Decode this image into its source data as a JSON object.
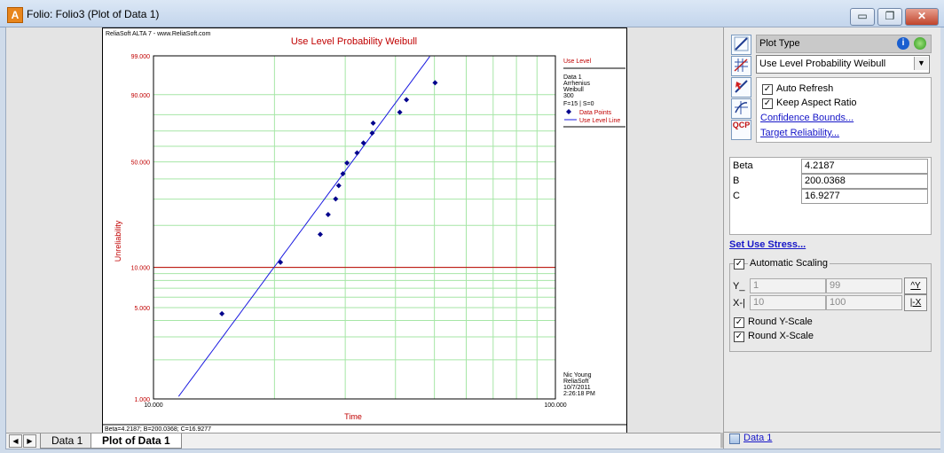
{
  "window": {
    "title": "Folio: Folio3 (Plot of Data 1)",
    "app_icon": "A",
    "minimize_glyph": "▭",
    "restore_glyph": "❐",
    "close_glyph": "✕"
  },
  "plot": {
    "header": "ReliaSoft ALTA 7 - www.ReliaSoft.com",
    "title": "Use Level Probability Weibull",
    "ylabel": "Unreliability",
    "xlabel": "Time",
    "footer": "Beta=4.2187; B=200.0368; C=16.9277",
    "legend": {
      "heading": "Use Level",
      "lines": [
        "Data 1",
        "Arrhenius",
        "Weibull",
        "300",
        "F=15 | S=0"
      ],
      "points_label": "Data Points",
      "line_label": "Use Level Line"
    },
    "signature": [
      "Nic Young",
      "ReliaSoft",
      "10/7/2011",
      "2:26:18 PM"
    ]
  },
  "chart_data": {
    "type": "scatter",
    "title": "Use Level Probability Weibull",
    "xlabel": "Time",
    "ylabel": "Unreliability",
    "xscale": "log",
    "yscale": "weibull",
    "xlim": [
      10000,
      100000
    ],
    "ylim": [
      1,
      99
    ],
    "x_ticks": [
      "10.000",
      "100.000"
    ],
    "y_ticks": [
      "1.000",
      "5.000",
      "10.000",
      "50.000",
      "90.000",
      "99.000"
    ],
    "x_tick_values": [
      10000,
      100000
    ],
    "y_tick_values": [
      1,
      5,
      10,
      50,
      90,
      99
    ],
    "x_grid": [
      10000,
      20000,
      30000,
      40000,
      50000,
      60000,
      70000,
      80000,
      90000,
      100000
    ],
    "y_grid": [
      1,
      2,
      3,
      4,
      5,
      6,
      7,
      8,
      9,
      10,
      20,
      30,
      40,
      50,
      60,
      70,
      80,
      90,
      99
    ],
    "highlight_y": 10,
    "series": [
      {
        "name": "Data Points",
        "points": [
          [
            14800,
            4.5
          ],
          [
            20700,
            10.9
          ],
          [
            26000,
            17.3
          ],
          [
            27200,
            23.7
          ],
          [
            28400,
            30.1
          ],
          [
            28900,
            36.5
          ],
          [
            29600,
            42.9
          ],
          [
            30300,
            49.3
          ],
          [
            32100,
            55.7
          ],
          [
            33300,
            62.2
          ],
          [
            35000,
            68.6
          ],
          [
            35200,
            75.0
          ],
          [
            41000,
            81.4
          ],
          [
            42600,
            87.8
          ],
          [
            50200,
            94.2
          ]
        ]
      },
      {
        "name": "Use Level Line",
        "line": {
          "beta": 4.2187,
          "eta": 34000
        }
      }
    ],
    "colors": {
      "grid": "#a6e6a6",
      "points": "#00008c",
      "line": "#1a1ae0",
      "highlight": "#c00000",
      "ticks": "#c00000"
    }
  },
  "tabs": {
    "first_glyph": "◀",
    "next_glyph": "▶",
    "items": [
      "Data 1",
      "Plot of Data 1"
    ]
  },
  "panel": {
    "tool_icons": [
      "plot-line-icon",
      "plot-grid-icon",
      "reliability-pointer-icon",
      "grid-chart-icon",
      "qcp-icon"
    ],
    "qcp_label": "QCP",
    "plot_type_label": "Plot Type",
    "plot_type_value": "Use Level Probability Weibull",
    "info_glyph": "i",
    "auto_refresh": "Auto Refresh",
    "keep_aspect": "Keep Aspect Ratio",
    "confidence_bounds": "Confidence Bounds...",
    "target_reliability": "Target Reliability...",
    "params": [
      {
        "name": "Beta",
        "value": "4.2187"
      },
      {
        "name": "B",
        "value": "200.0368"
      },
      {
        "name": "C",
        "value": "16.9277"
      }
    ],
    "set_use_stress": "Set Use Stress...",
    "automatic_scaling": "Automatic Scaling",
    "y_label": "Y_",
    "x_label": "X-|",
    "y_min": "1",
    "y_max": "99",
    "x_min": "10",
    "x_max": "100",
    "y_btn": "^Y",
    "x_btn": "|-X",
    "round_y": "Round Y-Scale",
    "round_x": "Round X-Scale",
    "check_glyph": "✓",
    "bottom_item": "Data 1"
  }
}
